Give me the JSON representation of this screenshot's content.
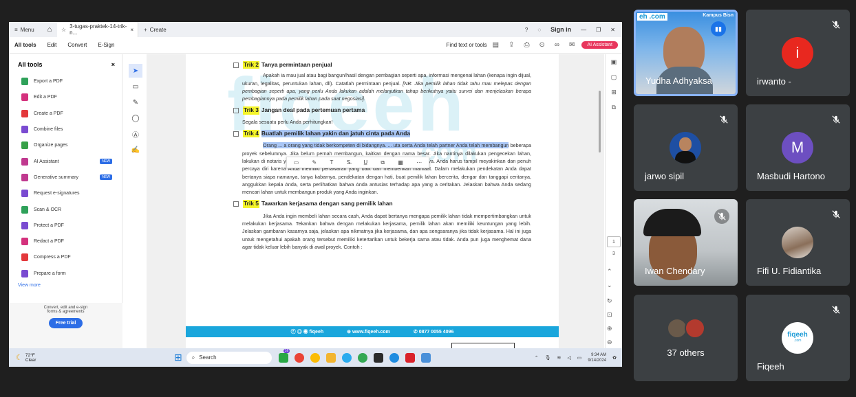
{
  "screen": {
    "titlebar": {
      "menu_label": "Menu",
      "tab_title": "3-tugas-praktek-14-trik-n...",
      "new_tab_label": "Create",
      "sign_in": "Sign in"
    },
    "toolbar": {
      "nav": [
        "All tools",
        "Edit",
        "Convert",
        "E-Sign"
      ],
      "find_label": "Find text or tools",
      "ai_button": "AI Assistant"
    },
    "sidebar": {
      "title": "All tools",
      "items": [
        {
          "label": "Export a PDF",
          "color": "#2fa15a"
        },
        {
          "label": "Edit a PDF",
          "color": "#d4317d"
        },
        {
          "label": "Create a PDF",
          "color": "#e3383b"
        },
        {
          "label": "Combine files",
          "color": "#7a4bd1"
        },
        {
          "label": "Organize pages",
          "color": "#37a148"
        },
        {
          "label": "AI Assistant",
          "color": "#c0398f",
          "badge": "NEW"
        },
        {
          "label": "Generative summary",
          "color": "#c0398f",
          "badge": "NEW"
        },
        {
          "label": "Request e-signatures",
          "color": "#7a4bd1"
        },
        {
          "label": "Scan & OCR",
          "color": "#2fa15a"
        },
        {
          "label": "Protect a PDF",
          "color": "#7a4bd1"
        },
        {
          "label": "Redact a PDF",
          "color": "#d4317d"
        },
        {
          "label": "Compress a PDF",
          "color": "#e3383b"
        },
        {
          "label": "Prepare a form",
          "color": "#7a4bd1"
        }
      ],
      "view_more": "View more",
      "trial_text_1": "Convert, edit and e-sign",
      "trial_text_2": "forms & agreements",
      "trial_button": "Free trial"
    },
    "document": {
      "watermark": "fiqeeh",
      "watermark_com": ".com",
      "trik2_label": "Trik 2",
      "trik2_title": "Tanya permintaan penjual",
      "trik2_para_a": "Apakah ia mau jual atau bagi bangun/hasil dengan pembagian seperti apa, informasi mengenai lahan (kenapa ingin dijual, ukuran, legalitas, peruntukan lahan, dll). Catatlah permintaan penjual.",
      "trik2_para_b": "[NB: Jika pemilik lahan tidak tahu mau melepas dengan pembagian seperti apa, yang perlu Anda lakukan adalah melanjutkan tahap berikutnya yaitu survei dan menjelaskan berapa pembagiannya pada pemilik lahan pada saat negosiasi].",
      "trik3_label": "Trik 3",
      "trik3_title": "Jangan deal pada pertemuan pertama",
      "trik3_para": "Segala sesuatu perlu Anda perhitungkan!",
      "trik4_label": "Trik 4",
      "trik4_title": "Buatlah pemilik lahan yakin dan jatuh cinta pada Anda",
      "trik4_para_sel": "Orang ... a orang yang tidak berkompeten di bidangnya. ... uta serta Anda telah partner Anda telah membangun",
      "trik4_para": "beberapa proyek sebelumnya. Jika belum pernah membangun, kaitkan dengan nama besar. Jika nantinya dilakukan pengecekan lahan, lakukan di notaris yang biasa digunakan oleh notaris bank yang sudah Anda percaya. Anda harus tampil meyakinkan dan penuh percaya diri karena Anda memiliki penawaran yang baik dan memberikan manfaat. Dalam melakukan pendekatan Anda dapat bertanya siapa namanya, tanya kabarnya, pendekatan dengan hati, buat pemilik lahan bercerita, dengar dan tanggapi ceritanya, anggukkan kepala Anda, serta perlihatkan bahwa Anda antusias terhadap apa yang a ceritakan. Jelaskan bahwa Anda sedang mencari lahan untuk membangun produk yang Anda inginkan.",
      "trik5_label": "Trik 5",
      "trik5_title": "Tawarkan kerjasama dengan sang pemilik lahan",
      "trik5_para": "Jika Anda ingin membeli lahan secara cash, Anda dapat bertanya mengapa pemilik lahan tidak mempertimbangkan untuk melakukan kerjasama. Tekankan bahwa dengan melakukan kerjasama, pemilik lahan akan memiliki keuntungan yang lebih. Jelaskan gambaran kasarnya saja, jelaskan apa nikmatnya jika kerjasama, dan apa sengsaranya jika tidak kerjasama. Hal ini juga untuk mengetahui apakah orang tersebut memiliki ketertarikan untuk bekerja sama atau tidak. Anda pun juga menghemat dana agar tidak keluar lebih banyak di awal proyek. Contoh :",
      "footer_handle": "fiqeeh",
      "footer_site": "www.fiqeeh.com",
      "footer_phone": "0877 0055 4096"
    },
    "page_nav": {
      "current": "1",
      "total": "3"
    },
    "taskbar": {
      "temp": "72°F",
      "weather": "Clear",
      "search": "Search",
      "chat_badge": "16",
      "time": "9:34 AM",
      "date": "9/14/2024"
    }
  },
  "participants": [
    {
      "name": "Yudha Adhyaksa",
      "org_label": "Kampus Bisn",
      "logo": "eh .com",
      "speaking": true
    },
    {
      "name": "irwanto -",
      "initial": "i",
      "color": "#e8281f",
      "muted": true
    },
    {
      "name": "jarwo sipil",
      "muted": true
    },
    {
      "name": "Masbudi Hartono",
      "initial": "M",
      "color": "#6d4fc1",
      "muted": true
    },
    {
      "name": "Iwan Chendary",
      "muted": true
    },
    {
      "name": "Fifi U. Fidiantika",
      "muted": true
    },
    {
      "name": "37 others"
    },
    {
      "name": "Fiqeeh",
      "logo": "fiqeeh",
      "logo_sub": ".com",
      "muted": true
    }
  ]
}
